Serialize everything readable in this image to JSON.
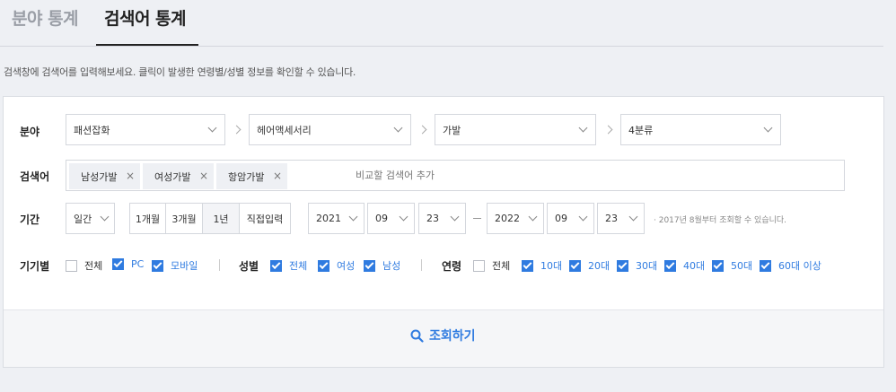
{
  "tabs": [
    {
      "label": "분야 통계",
      "active": false
    },
    {
      "label": "검색어 통계",
      "active": true
    }
  ],
  "description": "검색창에 검색어를 입력해보세요. 클릭이 발생한 연령별/성별 정보를 확인할 수 있습니다.",
  "field": {
    "label": "분야",
    "selects": [
      "패션잡화",
      "헤어액세서리",
      "가발",
      "4분류"
    ]
  },
  "keywords": {
    "label": "검색어",
    "tags": [
      "남성가발",
      "여성가발",
      "항암가발"
    ],
    "remove_glyph": "×",
    "placeholder": "비교할 검색어 추가"
  },
  "period": {
    "label": "기간",
    "unit": "일간",
    "buttons": [
      "1개월",
      "3개월",
      "1년",
      "직접입력"
    ],
    "active_button": "1년",
    "start": {
      "year": "2021",
      "month": "09",
      "day": "23"
    },
    "end": {
      "year": "2022",
      "month": "09",
      "day": "23"
    },
    "note": "· 2017년 8월부터 조회할 수 있습니다."
  },
  "device": {
    "label": "기기별",
    "options": [
      {
        "label": "전체",
        "checked": false
      },
      {
        "label": "PC",
        "checked": true
      },
      {
        "label": "모바일",
        "checked": true
      }
    ]
  },
  "gender": {
    "label": "성별",
    "options": [
      {
        "label": "전체",
        "checked": true
      },
      {
        "label": "여성",
        "checked": true
      },
      {
        "label": "남성",
        "checked": true
      }
    ]
  },
  "age": {
    "label": "연령",
    "options": [
      {
        "label": "전체",
        "checked": false
      },
      {
        "label": "10대",
        "checked": true
      },
      {
        "label": "20대",
        "checked": true
      },
      {
        "label": "30대",
        "checked": true
      },
      {
        "label": "40대",
        "checked": true
      },
      {
        "label": "50대",
        "checked": true
      },
      {
        "label": "60대 이상",
        "checked": true
      }
    ]
  },
  "search_button": {
    "label": "조회하기",
    "icon": "search-icon"
  },
  "colors": {
    "accent": "#2f7be0",
    "background": "#eef0f4",
    "text": "#333333"
  }
}
